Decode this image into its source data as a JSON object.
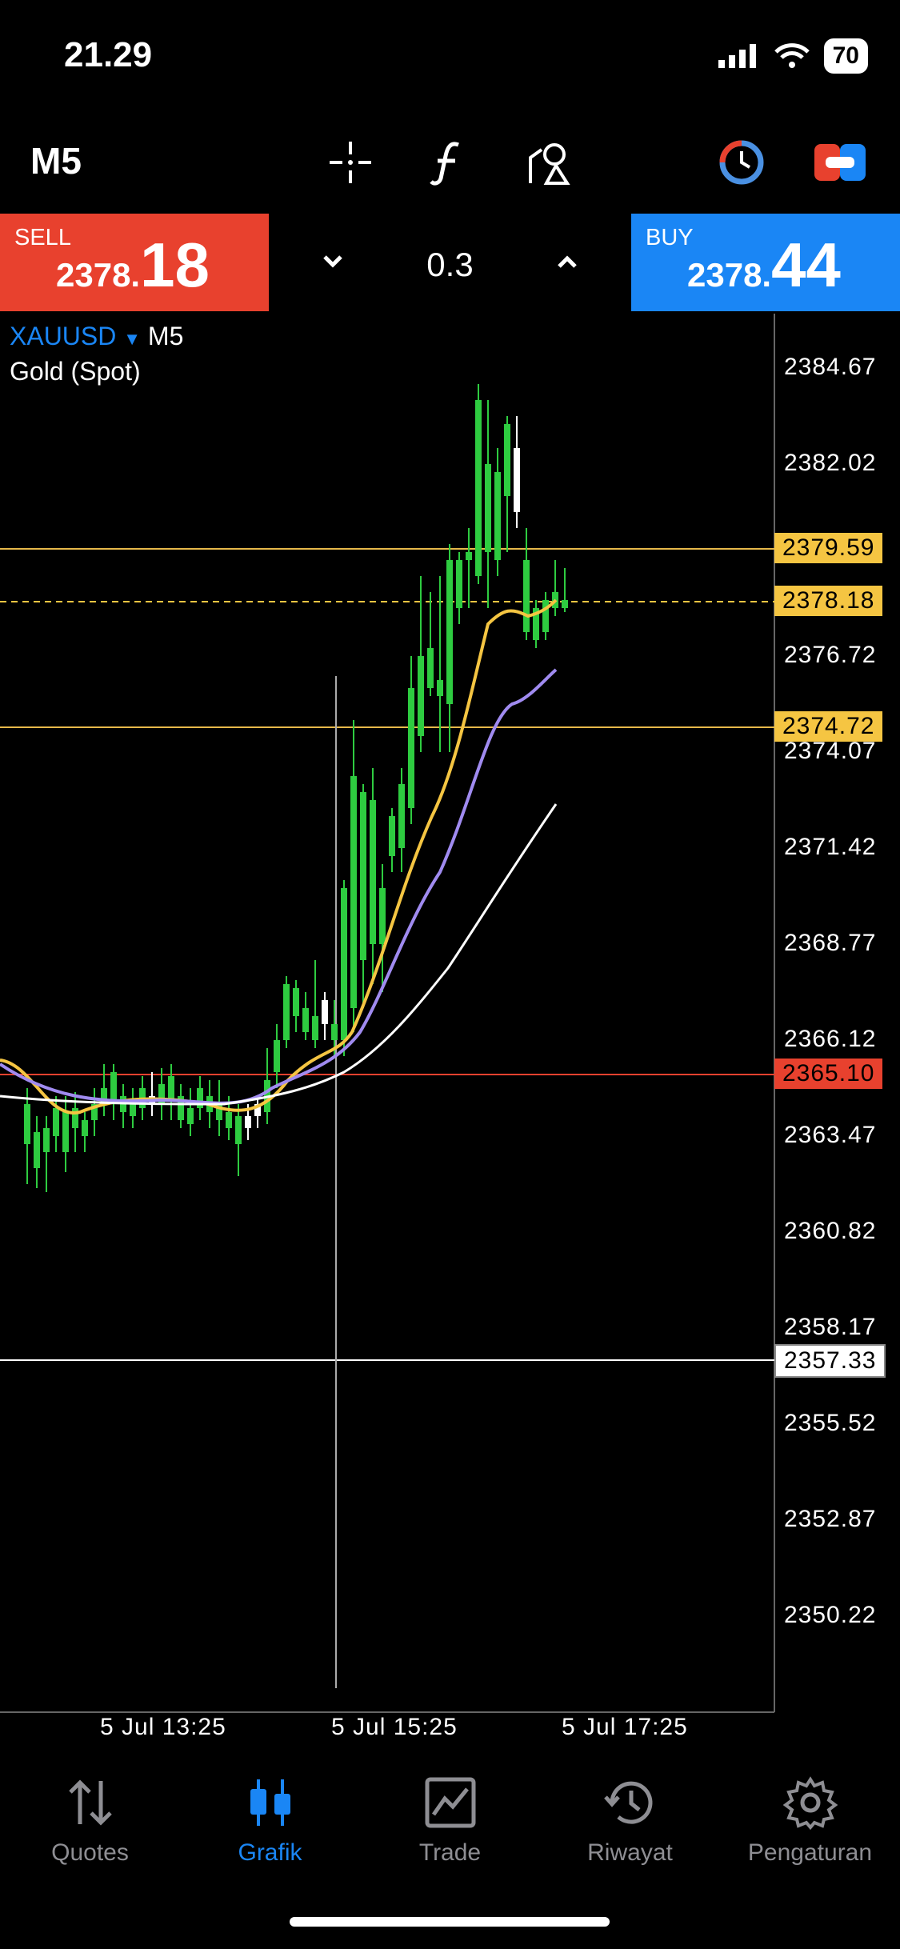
{
  "status": {
    "time": "21.29",
    "battery": "70"
  },
  "toolbar": {
    "period": "M5"
  },
  "trade": {
    "sell": {
      "label": "SELL",
      "price_small": "2378.",
      "price_big": "18"
    },
    "buy": {
      "label": "BUY",
      "price_small": "2378.",
      "price_big": "44"
    },
    "volume": "0.3"
  },
  "chart": {
    "symbol": "XAUUSD",
    "timeframe": "M5",
    "description": "Gold (Spot)",
    "price_axis": [
      "2384.67",
      "2382.02",
      "2376.72",
      "2374.07",
      "2371.42",
      "2368.77",
      "2366.12",
      "2363.47",
      "2360.82",
      "2358.17",
      "2355.52",
      "2352.87",
      "2350.22"
    ],
    "levels": {
      "line1": "2379.59",
      "bid": "2378.18",
      "line2": "2374.72",
      "red": "2365.10",
      "crosshair": "2357.33"
    },
    "time_axis": [
      "5 Jul 13:25",
      "5 Jul 15:25",
      "5 Jul 17:25"
    ],
    "colors": {
      "up": "#ffffff",
      "down": "#2ecc40",
      "ma_fast": "#f5c542",
      "ma_mid": "#a08bf0",
      "ma_slow": "#ffffff",
      "level": "#e6b84a",
      "red": "#e8412e"
    }
  },
  "nav": [
    {
      "label": "Quotes",
      "icon": "arrows-updown-icon"
    },
    {
      "label": "Grafik",
      "icon": "candles-icon"
    },
    {
      "label": "Trade",
      "icon": "trade-chart-icon"
    },
    {
      "label": "Riwayat",
      "icon": "history-icon"
    },
    {
      "label": "Pengaturan",
      "icon": "gear-icon"
    }
  ]
}
